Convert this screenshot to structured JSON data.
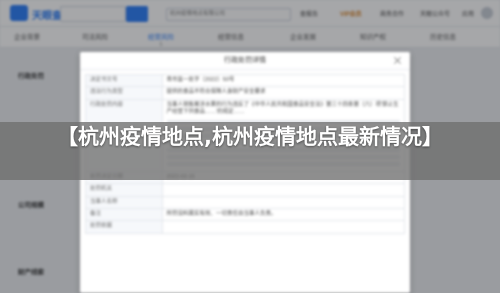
{
  "topbar": {
    "logo_text": "天眼查",
    "search_text": "请输入公司名称、老板姓名、品牌名称等",
    "nav_search_text": "杭州疫情地点有限公司",
    "links": [
      "查报告",
      "VIP会员",
      "商务合作",
      "天眼公众号",
      "应用"
    ]
  },
  "tabs": [
    {
      "label": "企业背景",
      "count": ""
    },
    {
      "label": "司法风险",
      "count": ""
    },
    {
      "label": "经营风险",
      "count": "5"
    },
    {
      "label": "经营信息",
      "count": ""
    },
    {
      "label": "企业发展",
      "count": ""
    },
    {
      "label": "知识产权",
      "count": ""
    },
    {
      "label": "历史信息",
      "count": ""
    }
  ],
  "sections": [
    "行政处罚",
    "公司规模",
    "财产线索"
  ],
  "modal": {
    "title": "行政处罚详情",
    "rows": [
      {
        "key": "决定书文号",
        "value": "青市监一处字〔2022〕50号"
      },
      {
        "key": "违法行为类型",
        "value": "提供的食品不符合保障人身财产安全要求"
      },
      {
        "key": "行政处罚内容",
        "value": "当事人销售案涉水果的行为违反了《中华人民共和国食品安全法》第三十四条第（六）项'禁止生产经营下列食品……'的规定……"
      },
      {
        "key": "处罚决定日期",
        "value": "2022-03-15"
      },
      {
        "key": "处罚机关",
        "value": ""
      },
      {
        "key": "当事人名称",
        "value": ""
      },
      {
        "key": "备注",
        "value": "所罚没料属实有效、一切责任自当事人负责。"
      },
      {
        "key": "处罚依据",
        "value": ""
      }
    ]
  },
  "headline": "【杭州疫情地点,杭州疫情地点最新情况】"
}
